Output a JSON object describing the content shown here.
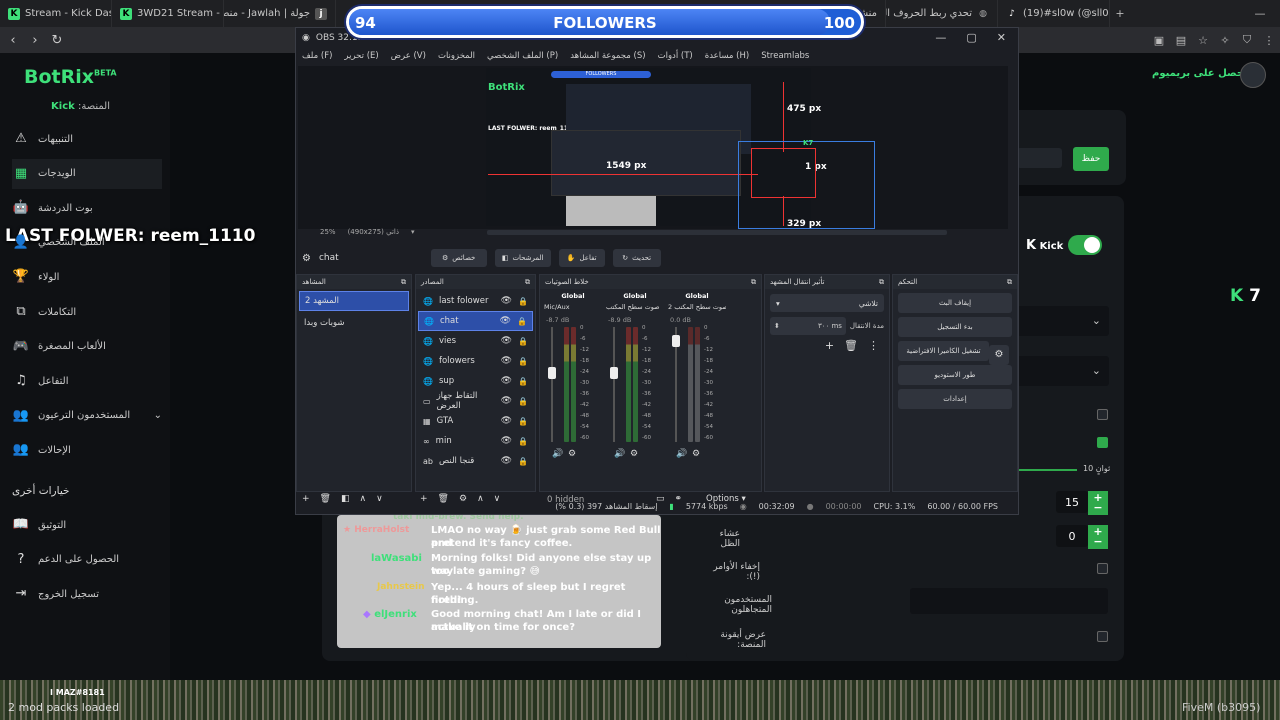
{
  "browser": {
    "tabs": [
      {
        "label": "Stream - Kick Dashbo",
        "fav": "K",
        "color": "#3ee07a"
      },
      {
        "label": "3WD21 Stream - Watc",
        "fav": "K",
        "color": "#3ee07a"
      },
      {
        "label": "جولة | Jawlah - منصة",
        "fav": "j",
        "color": "#888"
      }
    ],
    "right_tabs": [
      {
        "label": "منشور"
      },
      {
        "label": "تحدي ربط الحروف العرب"
      },
      {
        "label": "(19)#sl0w (@sll0ow)"
      }
    ]
  },
  "sidebar": {
    "logo": "BotRix",
    "beta": "BETA",
    "platform_label": "المنصة:",
    "platform_value": "Kick",
    "items": [
      {
        "label": "التنبيهات",
        "icon": "⚠",
        "name": "alerts"
      },
      {
        "label": "الويدجات",
        "icon": "▦",
        "name": "widgets"
      },
      {
        "label": "بوت الدردشة",
        "icon": "🤖",
        "name": "chat-bot"
      },
      {
        "label": "الملف الشخصي",
        "icon": "👤",
        "name": "profile"
      },
      {
        "label": "الولاء",
        "icon": "🏆",
        "name": "loyalty"
      },
      {
        "label": "التكاملات",
        "icon": "⧉",
        "name": "integrations"
      },
      {
        "label": "الألعاب المصغرة",
        "icon": "🎮",
        "name": "minigames"
      },
      {
        "label": "التفاعل",
        "icon": "♫",
        "name": "interaction"
      },
      {
        "label": "المستخدمون الترعيون",
        "icon": "👥",
        "name": "sub-users"
      },
      {
        "label": "الإحالات",
        "icon": "👥",
        "name": "referrals"
      }
    ],
    "other_heading": "خيارات أخرى",
    "other": [
      {
        "label": "التوثيق",
        "icon": "📖",
        "name": "docs"
      },
      {
        "label": "الحصول على الدعم",
        "icon": "?",
        "name": "support"
      },
      {
        "label": "تسجيل الخروج",
        "icon": "⇥",
        "name": "logout"
      }
    ]
  },
  "overlay": {
    "last_follower": "LAST FOLWER: reem_1110"
  },
  "followers": {
    "title": "FOLLOWERS",
    "current": "94",
    "goal": "100",
    "progress": 0.94
  },
  "premium": {
    "label": "احصل على بريميوم"
  },
  "obs": {
    "title": "OBS 32.1.1",
    "menu": [
      "ملف (F)",
      "تحرير (E)",
      "عرض (V)",
      "المخزونات",
      "الملف الشخصي (P)",
      "مجموعة المشاهد (S)",
      "أدوات (T)",
      "مساعدة (H)",
      "Streamlabs"
    ],
    "zoom": "25%",
    "resolution": "(490x275) ذاتي",
    "preview": {
      "height_top": "475 px",
      "left_px": "1549 px",
      "right_px": "1 px",
      "bottom_px": "329 px",
      "mini_last": "LAST FOLWER: reem_1110",
      "mini_followers": "FOLLOWERS",
      "mini_logo": "BotRix"
    },
    "source_bar": {
      "current": "chat",
      "properties": "خصائص",
      "filters": "المرشحات",
      "interact": "تفاعل",
      "refresh": "تحديث"
    },
    "docks": {
      "scenes": "المشاهد",
      "sources": "المصادر",
      "mixer": "خلاط الصوتيات",
      "transitions": "تأثير انتقال المشهد",
      "controls": "التحكم"
    },
    "scenes": [
      "المشهد 2",
      "شوبات وبدا"
    ],
    "sources": [
      {
        "label": "last folower",
        "icon": "🌐"
      },
      {
        "label": "chat",
        "icon": "🌐"
      },
      {
        "label": "vies",
        "icon": "🌐"
      },
      {
        "label": "folowers",
        "icon": "🌐"
      },
      {
        "label": "sup",
        "icon": "🌐"
      },
      {
        "label": "التقاط جهاز العرض",
        "icon": "▭"
      },
      {
        "label": "GTA",
        "icon": "▦"
      },
      {
        "label": "min",
        "icon": "∞"
      },
      {
        "label": "قنجا النص",
        "icon": "ab"
      }
    ],
    "mixer": [
      {
        "tag": "Global",
        "name": "Mic/Aux",
        "db": "-8.7 dB"
      },
      {
        "tag": "Global",
        "name": "صوت سطح المكتب",
        "db": "-8.9 dB"
      },
      {
        "tag": "Global",
        "name": "صوت سطح المكتب 2",
        "db": "0.0 dB"
      }
    ],
    "scale": [
      "0",
      "-6",
      "-12",
      "-18",
      "-24",
      "-30",
      "-36",
      "-42",
      "-48",
      "-54",
      "-60"
    ],
    "transition": {
      "type": "تلاشي",
      "duration_label": "مدة الانتقال",
      "duration": "٣٠٠ ms"
    },
    "controls": [
      "إيقاف البث",
      "بدء التسجيل",
      "تشغيل الكاميرا الافتراضية",
      "طور الاستوديو",
      "إعدادات"
    ],
    "hidden": "0 hidden",
    "options": "Options",
    "status": {
      "dropped": "إسقاط المشاهد 397 (0.3 %)",
      "kbps": "5774 kbps",
      "live": "00:32:09",
      "rec": "00:00:00",
      "cpu": "CPU: 3.1%",
      "fps": "60.00 / 60.00 FPS"
    }
  },
  "chat": {
    "messages": [
      {
        "user": "",
        "text": "LMAO no way 🍺 just grab some Red Bull and"
      },
      {
        "user": "",
        "text": "pretend it's fancy coffee."
      },
      {
        "user": "laWasabi",
        "text": "Morning folks! Did anyone else stay up way"
      },
      {
        "user": "",
        "text": "too late gaming? 😅"
      },
      {
        "user": "",
        "text": "Yep... 4 hours of sleep but I regret nothing."
      },
      {
        "user": "",
        "text": "fired!"
      },
      {
        "user": "elJenrix",
        "text": "Good morning chat! Am I late or did I actually"
      },
      {
        "user": "",
        "text": "make it on time for once?"
      }
    ]
  },
  "settings": {
    "save": "حفظ",
    "kick_label": "Kick",
    "kick_count": "7",
    "num1": "15",
    "num2": "0",
    "row_shadow": "عشاء الظل",
    "row_commands": "إخفاء الأوامر (!):",
    "row_ignored": "المستخدمون المتجاهلون",
    "row_platform": "عرض أيقونة المنصة:",
    "seconds": "ثوانٍ 10"
  },
  "footer": {
    "mods": "2 mod packs loaded",
    "user": "I MAZ#8181",
    "version": "FiveM (b3095)"
  }
}
